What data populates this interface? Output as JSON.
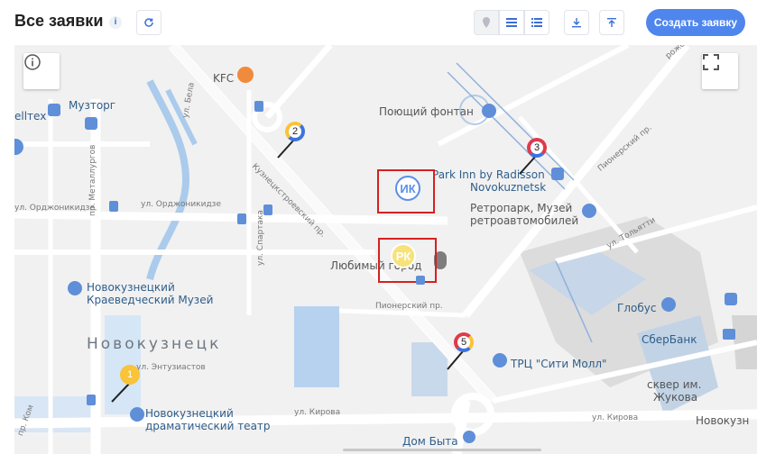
{
  "toolbar": {
    "title": "Все заявки",
    "info_icon": "info-icon",
    "refresh_icon": "refresh-icon",
    "view_buttons": [
      "map-pin-icon",
      "list-view-icon",
      "list-detail-icon"
    ],
    "download_icon": "download-icon",
    "filter_icon": "filter-icon",
    "create_label": "Создать заявку",
    "accent": "#4f86ee"
  },
  "map": {
    "info_button_icon": "info-icon",
    "fullscreen_icon": "fullscreen-icon",
    "city_label": "Новокузнецк",
    "pois": {
      "kfc": "KFC",
      "muztorg": "Музторг",
      "elltex": "ellтex",
      "fountain": "Поющий фонтан",
      "park_inn_1": "Park Inn by Radisson",
      "park_inn_2": "Novokuznetsk",
      "retropark_1": "Ретропарк, Музей",
      "retropark_2": "ретроавтомобилей",
      "lyubimy": "Любимый город",
      "museum_1": "Новокузнецкий",
      "museum_2": "Краеведческий Музей",
      "globus": "Глобус",
      "sberbank": "СберБанк",
      "trc": "ТРЦ \"Сити Молл\"",
      "skver_1": "сквер им.",
      "skver_2": "Жукова",
      "theatre_1": "Новокузнецкий",
      "theatre_2": "драматический театр",
      "dom_byta": "Дом Быта",
      "novokuz_edge": "Новокузн"
    },
    "streets": {
      "kuznetsk": "Кузнецкстроевский пр.",
      "ordzhonikidze": "ул. Орджоникидзе",
      "metallurgov": "пр. Металлургов",
      "pionersky": "Пионерский пр.",
      "pionersky2": "Пионерский пр.",
      "tolyatti": "ул. Тольятти",
      "spartaka": "ул. Спартака",
      "belana": "ул. Бела",
      "kirova1": "ул. Кирова",
      "kirova2": "ул. Кирова",
      "entuziastov": "ул. Энтузиастов",
      "ordzhon_left": "ул. Орджоникидзе",
      "rozhskaya": "рожская",
      "pr_kom": "пр. Ком"
    },
    "markers": [
      {
        "label": "1",
        "colors": [
          "#f9c33a"
        ]
      },
      {
        "label": "2",
        "colors": [
          "#f9c33a",
          "#3c73e0"
        ]
      },
      {
        "label": "3",
        "colors": [
          "#e03a4a",
          "#3c73e0"
        ]
      },
      {
        "label": "5",
        "colors": [
          "#e03a4a",
          "#f9c33a",
          "#3c73e0"
        ]
      }
    ],
    "pins": [
      {
        "label": "ИК",
        "color": "#5b8fe8"
      },
      {
        "label": "РК",
        "color": "#f7e27a"
      }
    ],
    "highlight_color": "#d62020"
  }
}
